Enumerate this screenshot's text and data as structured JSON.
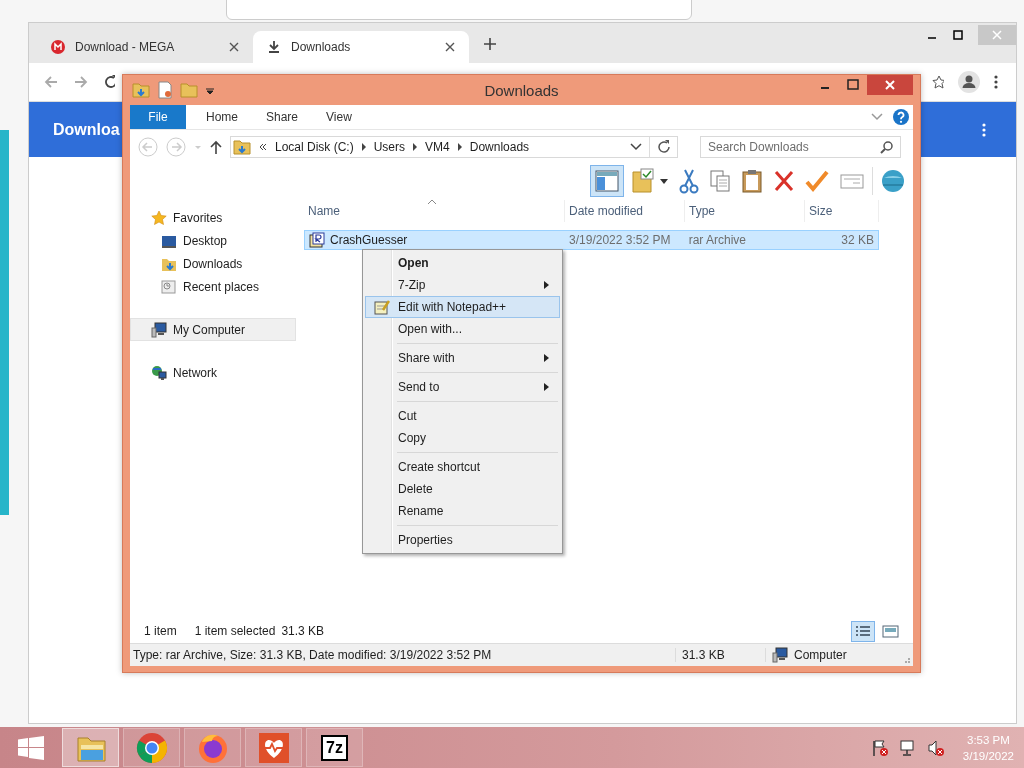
{
  "browser": {
    "tabs": [
      {
        "label": "Download - MEGA",
        "kind": "mega",
        "selected": false
      },
      {
        "label": "Downloads",
        "kind": "download",
        "selected": true
      }
    ],
    "page_heading": "Downloa"
  },
  "explorer": {
    "title": "Downloads",
    "ribbon_tabs": [
      {
        "label": "File",
        "kind": "file"
      },
      {
        "label": "Home",
        "kind": "tab"
      },
      {
        "label": "Share",
        "kind": "tab"
      },
      {
        "label": "View",
        "kind": "tab"
      }
    ],
    "address": [
      "Local Disk (C:)",
      "Users",
      "VM4",
      "Downloads"
    ],
    "search": {
      "placeholder": "Search Downloads"
    },
    "toolbar": [
      {
        "kind": "preview-pane",
        "selected": true
      },
      {
        "kind": "folder-options",
        "selected": false
      },
      {
        "kind": "cut",
        "selected": false
      },
      {
        "kind": "copy",
        "selected": false
      },
      {
        "kind": "paste",
        "selected": false
      },
      {
        "kind": "delete",
        "selected": false
      },
      {
        "kind": "check",
        "selected": false
      },
      {
        "kind": "rename",
        "selected": false
      },
      {
        "kind": "shell",
        "selected": false
      }
    ],
    "navigation": [
      {
        "label": "Favorites",
        "kind": "favorites",
        "selected": false,
        "children": [
          {
            "label": "Desktop",
            "kind": "desktop",
            "selected": false
          },
          {
            "label": "Downloads",
            "kind": "downloads",
            "selected": false
          },
          {
            "label": "Recent places",
            "kind": "recent",
            "selected": false
          }
        ]
      },
      {
        "label": "My Computer",
        "kind": "computer",
        "selected": true
      },
      {
        "label": "Network",
        "kind": "network",
        "selected": false
      }
    ],
    "columns": [
      "Name",
      "Date modified",
      "Type",
      "Size"
    ],
    "rows": [
      {
        "name": "CrashGuesser",
        "date_modified": "3/19/2022 3:52 PM",
        "type": "rar Archive",
        "size": "32 KB",
        "selected": true
      }
    ],
    "item_count": "1 item",
    "selection_info": "1 item selected",
    "selection_size": "31.3 KB",
    "view_buttons": [
      {
        "kind": "details",
        "selected": true
      },
      {
        "kind": "large-icons",
        "selected": false
      }
    ],
    "status_bar": {
      "details": "Type: rar Archive, Size: 31.3 KB, Date modified: 3/19/2022 3:52 PM",
      "size": "31.3 KB",
      "zone": "Computer"
    }
  },
  "context_menu": [
    {
      "kind": "item",
      "label": "Open",
      "bold": true,
      "submenu": false,
      "selected": false
    },
    {
      "kind": "item",
      "label": "7-Zip",
      "bold": false,
      "submenu": true,
      "selected": false
    },
    {
      "kind": "notepad",
      "label": "Edit with Notepad++",
      "bold": false,
      "submenu": false,
      "selected": true
    },
    {
      "kind": "item",
      "label": "Open with...",
      "bold": false,
      "submenu": false,
      "selected": false
    },
    {
      "kind": "separator"
    },
    {
      "kind": "item",
      "label": "Share with",
      "bold": false,
      "submenu": true,
      "selected": false
    },
    {
      "kind": "separator"
    },
    {
      "kind": "item",
      "label": "Send to",
      "bold": false,
      "submenu": true,
      "selected": false
    },
    {
      "kind": "separator"
    },
    {
      "kind": "item",
      "label": "Cut",
      "bold": false,
      "submenu": false,
      "selected": false
    },
    {
      "kind": "item",
      "label": "Copy",
      "bold": false,
      "submenu": false,
      "selected": false
    },
    {
      "kind": "separator"
    },
    {
      "kind": "item",
      "label": "Create shortcut",
      "bold": false,
      "submenu": false,
      "selected": false
    },
    {
      "kind": "item",
      "label": "Delete",
      "bold": false,
      "submenu": false,
      "selected": false
    },
    {
      "kind": "item",
      "label": "Rename",
      "bold": false,
      "submenu": false,
      "selected": false
    },
    {
      "kind": "separator"
    },
    {
      "kind": "item",
      "label": "Properties",
      "bold": false,
      "submenu": false,
      "selected": false
    }
  ],
  "taskbar": {
    "apps": [
      {
        "kind": "file-explorer",
        "selected": true
      },
      {
        "kind": "chrome",
        "selected": false
      },
      {
        "kind": "firefox",
        "selected": false
      },
      {
        "kind": "health",
        "selected": false
      },
      {
        "kind": "sevenzip",
        "label": "7z",
        "selected": false
      }
    ],
    "time": "3:53 PM",
    "date": "3/19/2022"
  }
}
